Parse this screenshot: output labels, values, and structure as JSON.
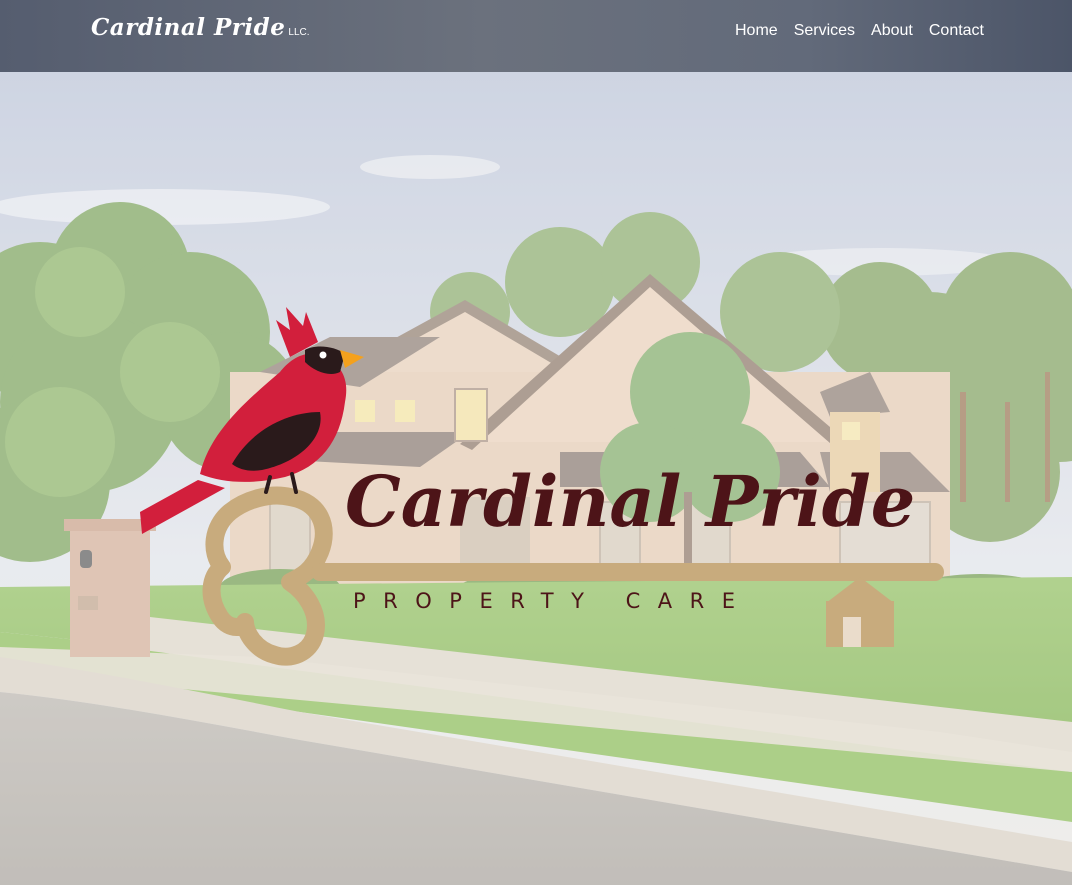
{
  "navbar": {
    "brand": "Cardinal Pride",
    "brand_suffix": "LLC.",
    "links": [
      "Home",
      "Services",
      "About",
      "Contact"
    ]
  },
  "hero": {
    "logo_title": "Cardinal Pride",
    "logo_subtitle": "PROPERTY CARE",
    "logo_icons": [
      "cardinal-bird-icon",
      "key-icon",
      "house-icon"
    ],
    "background": "house-photo"
  },
  "colors": {
    "navbar": "#5e6575",
    "logo_text": "#4d1418",
    "key_gold": "#c8ab7d",
    "cardinal_red": "#d21f3c",
    "beak_orange": "#f4a11d"
  }
}
